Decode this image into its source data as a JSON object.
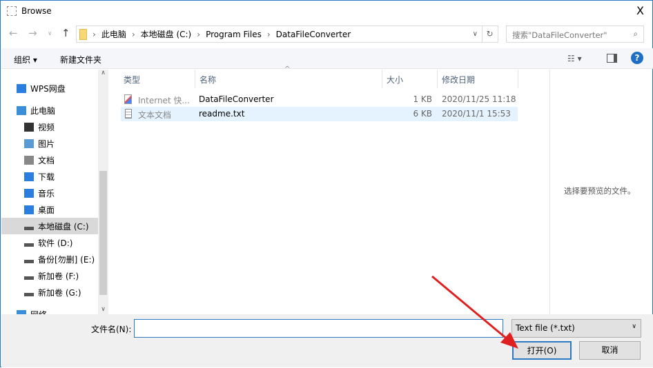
{
  "window": {
    "title": "Browse",
    "close": "X"
  },
  "address": {
    "crumbs": [
      "此电脑",
      "本地磁盘 (C:)",
      "Program Files",
      "DataFileConverter"
    ],
    "search_placeholder": "搜索\"DataFileConverter\""
  },
  "toolbar": {
    "organize": "组织 ▾",
    "new_folder": "新建文件夹"
  },
  "nav_items": [
    {
      "label": "WPS网盘",
      "icon": "cloud-icon"
    },
    {
      "label": "此电脑",
      "icon": "computer-icon"
    },
    {
      "label": "视频",
      "icon": "video-icon"
    },
    {
      "label": "图片",
      "icon": "picture-icon"
    },
    {
      "label": "文档",
      "icon": "document-icon"
    },
    {
      "label": "下载",
      "icon": "download-icon"
    },
    {
      "label": "音乐",
      "icon": "music-icon"
    },
    {
      "label": "桌面",
      "icon": "desktop-icon"
    },
    {
      "label": "本地磁盘 (C:)",
      "icon": "drive-icon",
      "selected": true
    },
    {
      "label": "软件 (D:)",
      "icon": "drive-icon"
    },
    {
      "label": "备份[勿删] (E:)",
      "icon": "drive-icon"
    },
    {
      "label": "新加卷 (F:)",
      "icon": "drive-icon"
    },
    {
      "label": "新加卷 (G:)",
      "icon": "drive-icon"
    },
    {
      "label": "网络",
      "icon": "network-icon"
    }
  ],
  "columns": {
    "type": "类型",
    "name": "名称",
    "size": "大小",
    "date": "修改日期"
  },
  "files": [
    {
      "type": "Internet 快...",
      "name": "DataFileConverter",
      "size": "1 KB",
      "date": "2020/11/25 11:18"
    },
    {
      "type": "文本文档",
      "name": "readme.txt",
      "size": "6 KB",
      "date": "2020/11/1 15:53"
    }
  ],
  "preview": {
    "text": "选择要预览的文件。"
  },
  "bottom": {
    "filename_label": "文件名(N):",
    "filename_value": "",
    "filter": "Text file (*.txt)",
    "open": "打开(O)",
    "cancel": "取消"
  },
  "colors": {
    "accent": "#2b79c2",
    "arrow": "#e02020"
  }
}
